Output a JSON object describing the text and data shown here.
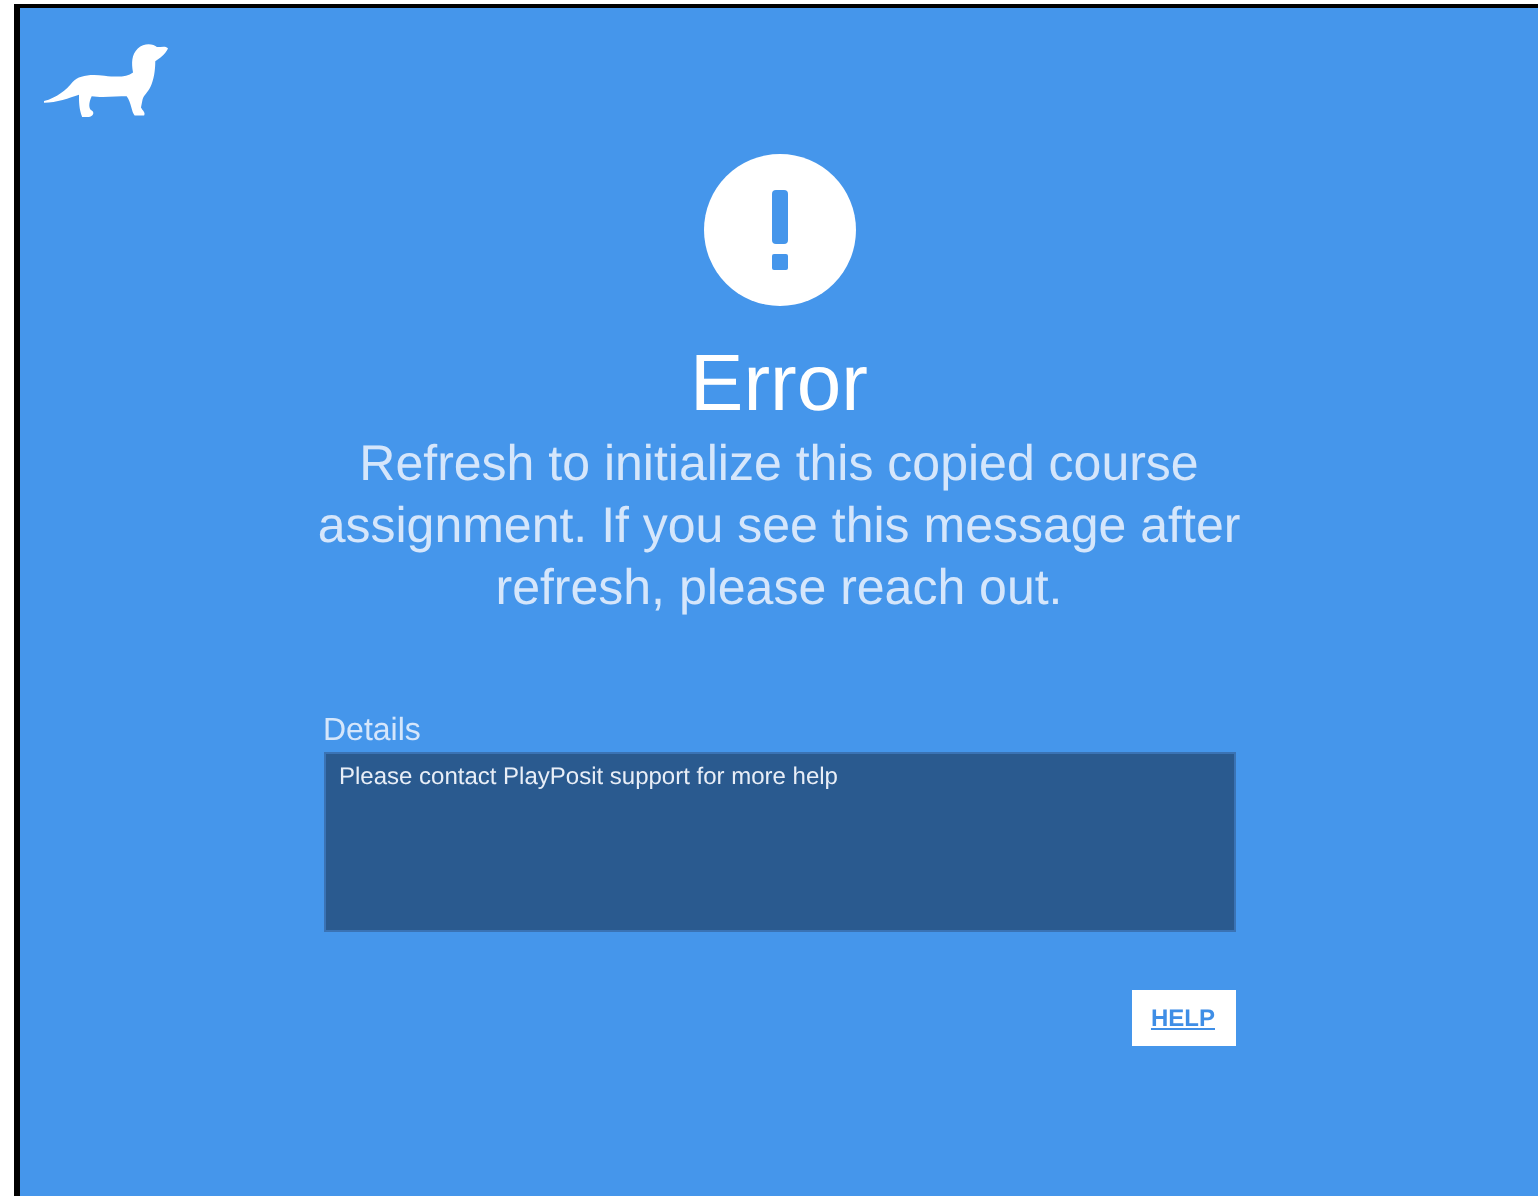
{
  "title": "Error",
  "message": "Refresh to initialize this copied course assignment. If you see this message after refresh, please reach out.",
  "details": {
    "label": "Details",
    "text": "Please contact PlayPosit support for more help"
  },
  "buttons": [
    "HELP"
  ]
}
